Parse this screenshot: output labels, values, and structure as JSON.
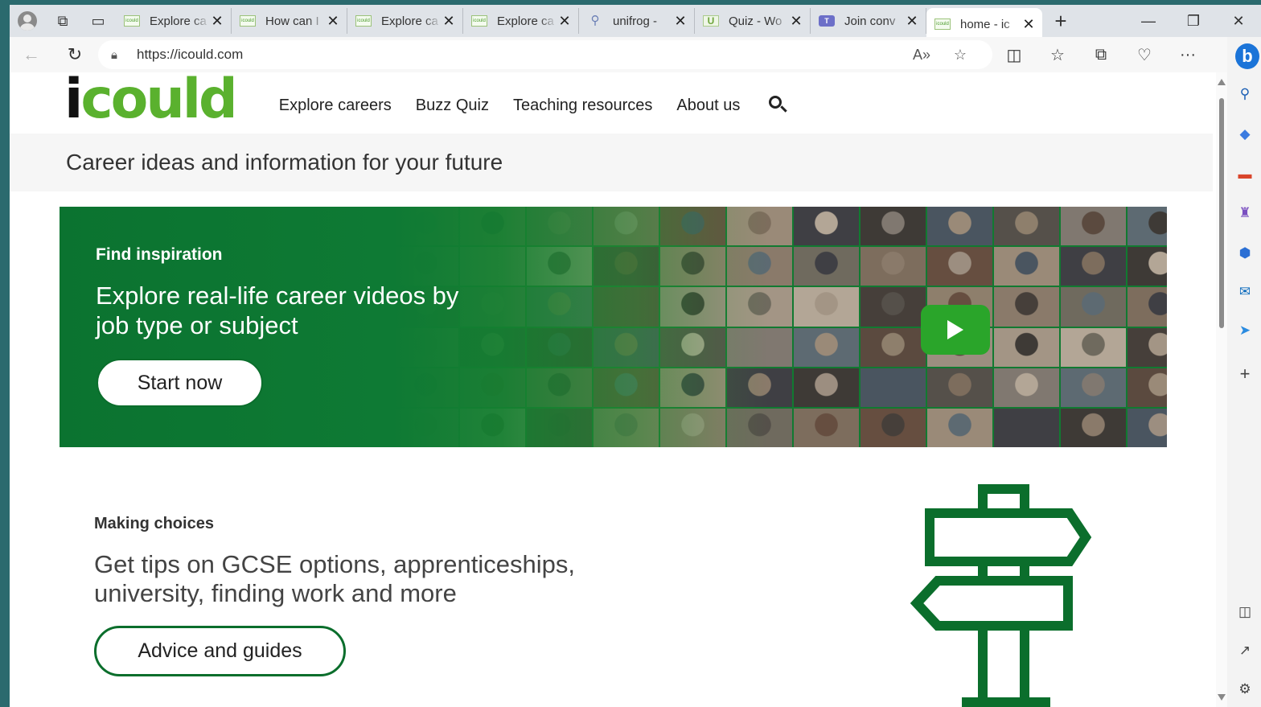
{
  "browser": {
    "tabs": [
      {
        "title": "Explore ca",
        "favicon": "icould-logo"
      },
      {
        "title": "How can I",
        "favicon": "icould-logo"
      },
      {
        "title": "Explore ca",
        "favicon": "icould-logo"
      },
      {
        "title": "Explore ca",
        "favicon": "icould-logo"
      },
      {
        "title": "unifrog -",
        "favicon": "search-icon"
      },
      {
        "title": "Quiz - Wo",
        "favicon": "u-logo"
      },
      {
        "title": "Join conv",
        "favicon": "teams-logo"
      },
      {
        "title": "home - ic",
        "favicon": "icould-logo",
        "active": true
      }
    ],
    "favicon_text": "icould",
    "teams_text": "T",
    "u_text": "U",
    "url": "https://icould.com"
  },
  "site": {
    "logo_i": "i",
    "logo_rest": "could",
    "nav": [
      "Explore careers",
      "Buzz Quiz",
      "Teaching resources",
      "About us"
    ],
    "tagline": "Career ideas and information for your future",
    "hero": {
      "kicker": "Find inspiration",
      "title": "Explore real-life career videos by job type or subject",
      "button": "Start now"
    },
    "making_choices": {
      "kicker": "Making choices",
      "title": "Get tips on GCSE options, apprenticeships, university, finding work and more",
      "button": "Advice and guides"
    }
  },
  "colors": {
    "brand_green": "#5ab12e",
    "dark_green": "#0b6e2c",
    "play_green": "#2aa52a"
  },
  "mosaic_tones": [
    "#5b4a3f",
    "#8a7a6a",
    "#3e3a36",
    "#9c8e80",
    "#6f6a5e",
    "#4a5560",
    "#a39585",
    "#7d6d5d",
    "#55504a",
    "#b3a696",
    "#664e40",
    "#807870",
    "#463f3a",
    "#9a8a78",
    "#5d6a72",
    "#8e7f6c",
    "#3f3f44"
  ]
}
